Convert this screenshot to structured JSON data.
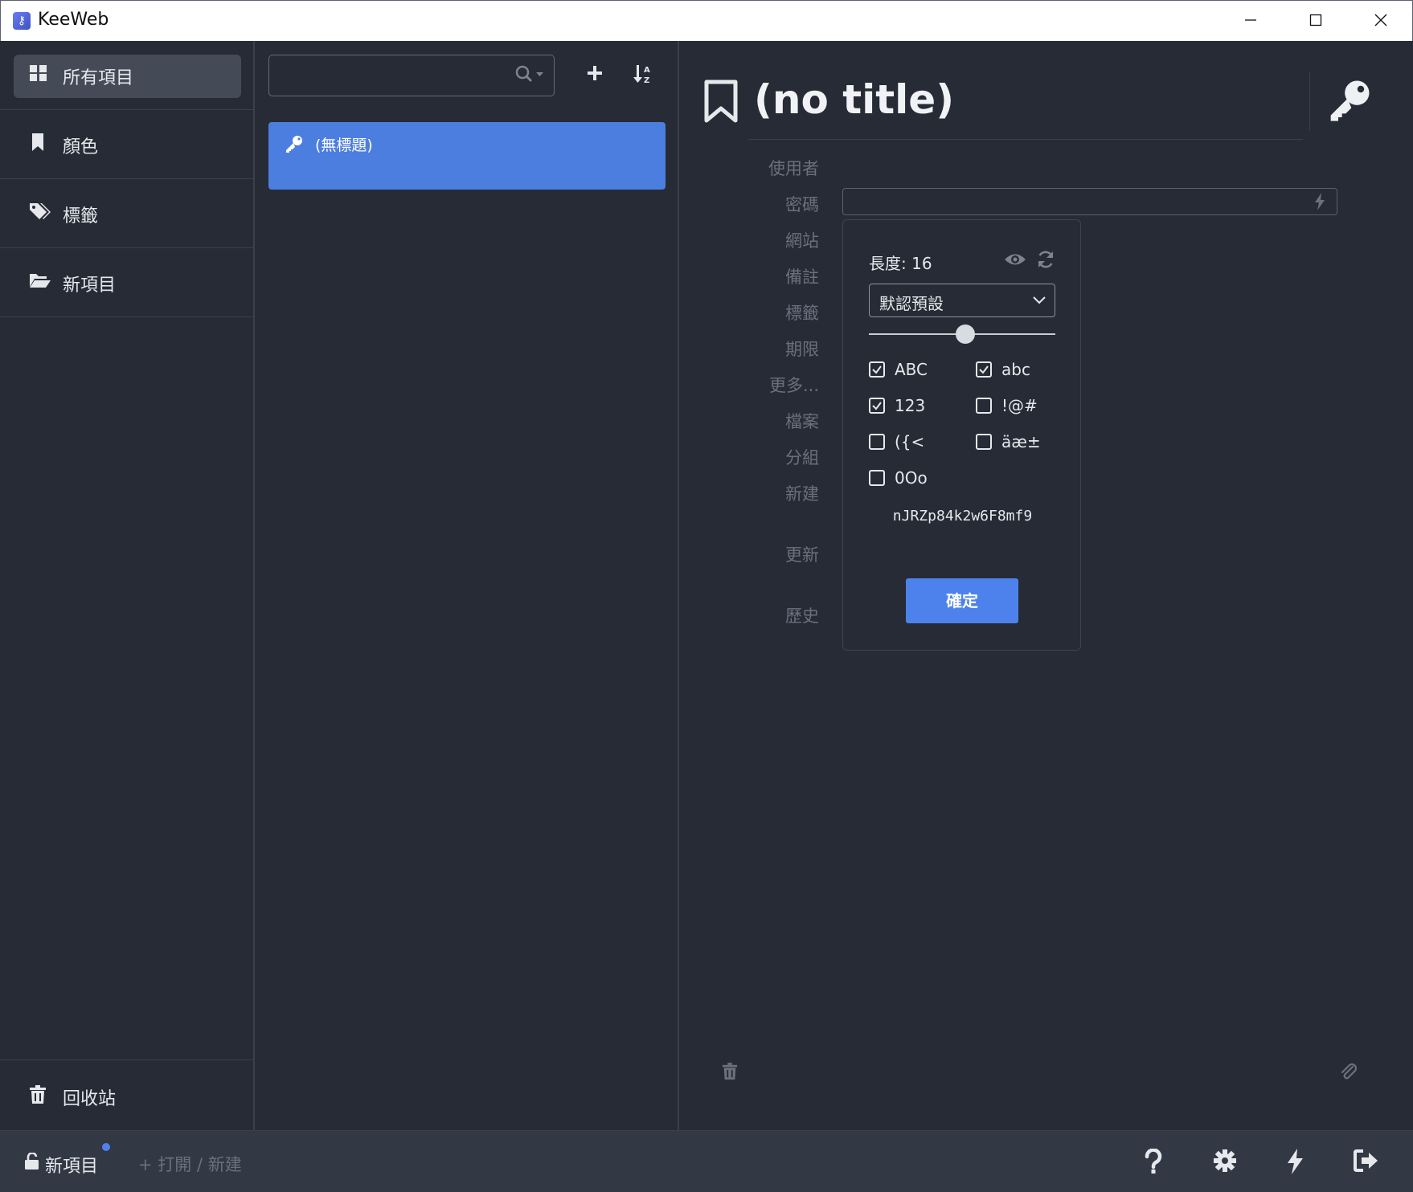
{
  "window": {
    "title": "KeeWeb",
    "min": "—",
    "max": "☐",
    "close": "✕"
  },
  "sidebar": {
    "items": [
      {
        "label": "所有項目",
        "icon": "grid-icon",
        "active": true
      },
      {
        "label": "顏色",
        "icon": "bookmark-icon"
      },
      {
        "label": "標籤",
        "icon": "tags-icon"
      },
      {
        "label": "新項目",
        "icon": "folder-open-icon"
      }
    ],
    "trash_label": "回收站"
  },
  "list": {
    "search_placeholder": "",
    "entries": [
      {
        "title": "(無標題)",
        "icon": "key-icon"
      }
    ]
  },
  "details": {
    "title": "(no title)",
    "field_labels": [
      "使用者",
      "密碼",
      "網站",
      "備註",
      "標籤",
      "期限",
      "更多...",
      "檔案",
      "分組",
      "新建",
      "更新",
      "歷史"
    ]
  },
  "generator": {
    "length_label": "長度: 16",
    "preset": "默認預設",
    "length_value": 16,
    "options": [
      {
        "label": "ABC",
        "checked": true
      },
      {
        "label": "abc",
        "checked": true
      },
      {
        "label": "123",
        "checked": true
      },
      {
        "label": "!@#",
        "checked": false
      },
      {
        "label": "({<",
        "checked": false
      },
      {
        "label": "äæ±",
        "checked": false
      },
      {
        "label": "0Oo",
        "checked": false
      }
    ],
    "generated_password": "nJRZp84k2w6F8mf9",
    "ok_label": "確定"
  },
  "footer": {
    "file_label": "新項目",
    "open_label": "+ 打開 / 新建",
    "accent": "#4d82ec"
  }
}
